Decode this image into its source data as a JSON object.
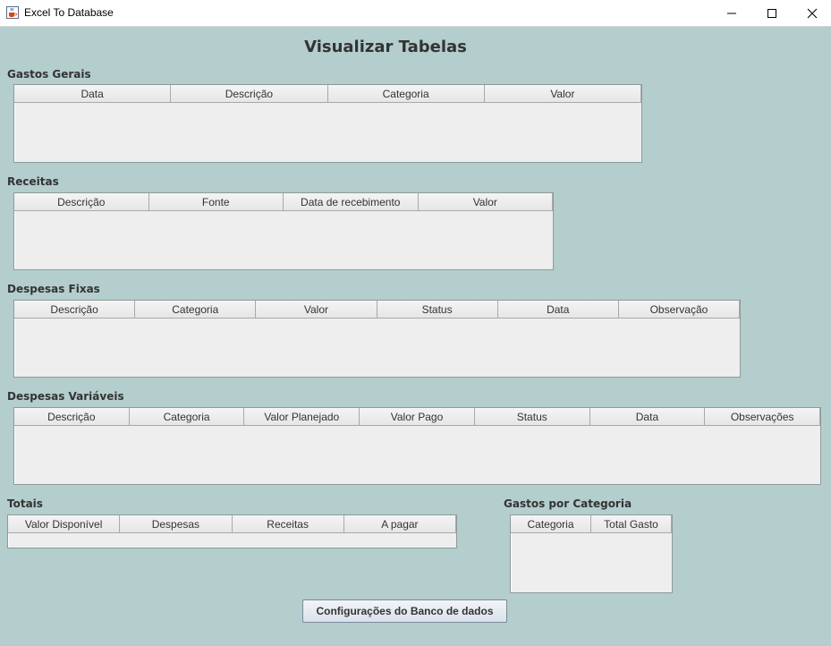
{
  "window": {
    "title": "Excel To Database",
    "app_icon": "java-cup-icon",
    "controls": [
      "minimize-icon",
      "maximize-icon",
      "close-icon"
    ]
  },
  "page": {
    "title": "Visualizar Tabelas"
  },
  "sections": {
    "gastos_gerais": {
      "label": "Gastos Gerais",
      "columns": [
        "Data",
        "Descrição",
        "Categoria",
        "Valor"
      ],
      "rows": []
    },
    "receitas": {
      "label": "Receitas",
      "columns": [
        "Descrição",
        "Fonte",
        "Data de recebimento",
        "Valor"
      ],
      "rows": []
    },
    "despesas_fixas": {
      "label": "Despesas Fixas",
      "columns": [
        "Descrição",
        "Categoria",
        "Valor",
        "Status",
        "Data",
        "Observação"
      ],
      "rows": []
    },
    "despesas_variaveis": {
      "label": "Despesas Variáveis",
      "columns": [
        "Descrição",
        "Categoria",
        "Valor Planejado",
        "Valor Pago",
        "Status",
        "Data",
        "Observações"
      ],
      "rows": []
    },
    "totais": {
      "label": "Totais",
      "columns": [
        "Valor Disponível",
        "Despesas",
        "Receitas",
        "A pagar"
      ],
      "rows": []
    },
    "gastos_por_categoria": {
      "label": "Gastos por Categoria",
      "columns": [
        "Categoria",
        "Total Gasto"
      ],
      "rows": []
    }
  },
  "buttons": {
    "db_config": "Configurações do Banco de dados"
  },
  "colors": {
    "background": "#b4cdcd",
    "table_bg": "#eeeeee",
    "text": "#333333"
  }
}
